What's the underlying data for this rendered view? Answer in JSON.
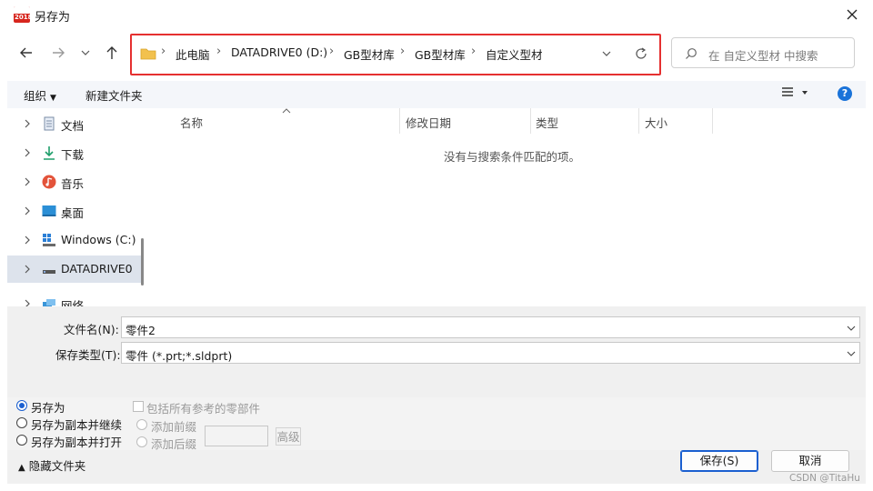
{
  "window": {
    "title": "另存为",
    "app_icon_text": "2018"
  },
  "address_bar": {
    "crumbs": [
      "此电脑",
      "DATADRIVE0 (D:)",
      "GB型材库",
      "GB型材库",
      "自定义型材"
    ]
  },
  "search": {
    "placeholder": "在 自定义型材 中搜索"
  },
  "toolbar": {
    "organize": "组织",
    "new_folder": "新建文件夹"
  },
  "nav_pane": {
    "items": [
      {
        "label": "文档",
        "icon": "document-icon"
      },
      {
        "label": "下载",
        "icon": "download-icon"
      },
      {
        "label": "音乐",
        "icon": "music-icon"
      },
      {
        "label": "桌面",
        "icon": "desktop-icon"
      },
      {
        "label": "Windows  (C:)",
        "icon": "windows-drive-icon"
      },
      {
        "label": "DATADRIVE0",
        "icon": "drive-icon",
        "selected": true
      },
      {
        "label": "网络",
        "icon": "network-icon"
      }
    ]
  },
  "file_list": {
    "columns": [
      "名称",
      "修改日期",
      "类型",
      "大小"
    ],
    "empty_message": "没有与搜索条件匹配的项。"
  },
  "save_fields": {
    "filename_label": "文件名(N):",
    "filename_value": "零件2",
    "filetype_label": "保存类型(T):",
    "filetype_value": "零件 (*.prt;*.sldprt)"
  },
  "options": {
    "save_as": "另存为",
    "save_copy_continue": "另存为副本并继续",
    "save_copy_open": "另存为副本并打开",
    "include_refs": "包括所有参考的零部件",
    "add_prefix": "添加前缀",
    "add_suffix": "添加后缀",
    "advanced": "高级"
  },
  "buttons": {
    "save": "保存(S)",
    "cancel": "取消",
    "hide_folders": "隐藏文件夹"
  },
  "watermark": "CSDN @TitaHu",
  "colors": {
    "accent": "#1a5fd0",
    "highlight_border": "#e53030",
    "help": "#1a73d9"
  }
}
